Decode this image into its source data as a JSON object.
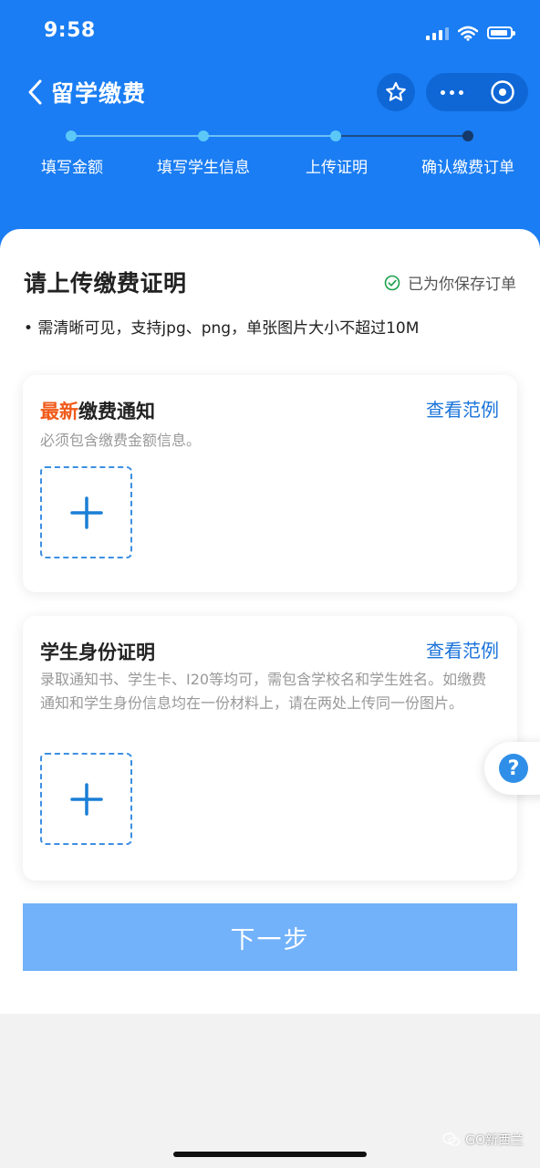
{
  "status_bar": {
    "time": "9:58"
  },
  "nav": {
    "title": "留学缴费"
  },
  "steps": [
    {
      "label": "填写金额"
    },
    {
      "label": "填写学生信息"
    },
    {
      "label": "上传证明"
    },
    {
      "label": "确认缴费订单"
    }
  ],
  "current_step": 3,
  "colors": {
    "brand_blue": "#1a7df3",
    "accent_orange": "#f05a1a",
    "link_blue": "#1a73d9",
    "button_disabled": "#72b2fa",
    "saved_green": "#1aa04a"
  },
  "section": {
    "title": "请上传缴费证明",
    "saved_text": "已为你保存订单",
    "notice": "• 需清晰可见，支持jpg、png，单张图片大小不超过10M"
  },
  "cards": [
    {
      "title_highlight": "最新",
      "title_rest": "缴费通知",
      "example_link": "查看范例",
      "description": "必须包含缴费金额信息。"
    },
    {
      "title": "学生身份证明",
      "example_link": "查看范例",
      "description": "录取通知书、学生卡、I20等均可，需包含学校名和学生姓名。如缴费通知和学生身份信息均在一份材料上，请在两处上传同一份图片。"
    }
  ],
  "next_button": {
    "label": "下一步"
  },
  "help_button": {
    "label": "?"
  },
  "watermark": {
    "text": "GO新西兰"
  },
  "icons": [
    "back-chevron-icon",
    "star-icon",
    "more-dots-icon",
    "close-circle-icon",
    "check-circle-icon",
    "plus-icon",
    "help-icon",
    "wechat-icon"
  ]
}
